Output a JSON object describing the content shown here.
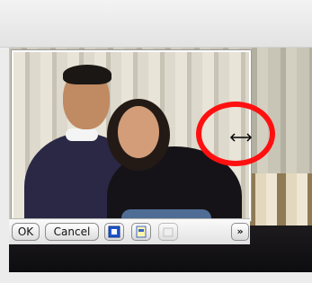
{
  "toolbar": {
    "ok_label": "OK",
    "cancel_label": "Cancel",
    "more_label": "»",
    "icons": [
      "layout-icon",
      "page-icon",
      "disabled-page-icon"
    ]
  },
  "colors": {
    "annotation_ring": "#ff1010",
    "toolbar_bg": "#e9e9e9",
    "icon_blue": "#1f57d0"
  }
}
